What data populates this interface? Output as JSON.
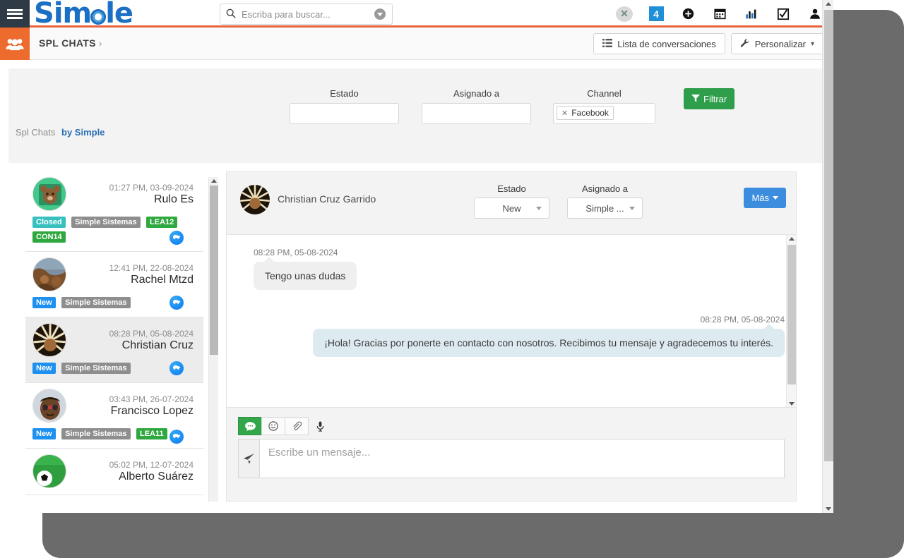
{
  "navbar": {
    "brand": "Simple",
    "menu_icon": "hamburger-icon",
    "search": {
      "placeholder": "Escriba para buscar...",
      "value": ""
    },
    "icons": [
      {
        "name": "xero-icon",
        "glyph": "✕"
      },
      {
        "name": "notification-count-icon",
        "glyph": "4"
      },
      {
        "name": "add-circle-icon",
        "glyph": "✚"
      },
      {
        "name": "calendar-icon",
        "glyph": "▦"
      },
      {
        "name": "chart-icon",
        "glyph": "▁▅▇"
      },
      {
        "name": "checklist-icon",
        "glyph": "☑"
      },
      {
        "name": "user-icon",
        "glyph": "👤"
      }
    ]
  },
  "breadcrumb": {
    "icon": "group-people-icon",
    "title": "SPL CHATS",
    "chevron": "›",
    "actions": [
      {
        "name": "conversation-list-button",
        "icon": "list-icon",
        "label": "Lista de conversaciones"
      },
      {
        "name": "customize-button",
        "icon": "wrench-icon",
        "label": "Personalizar",
        "caret": "▾"
      }
    ]
  },
  "filters": {
    "estado": {
      "label": "Estado",
      "value": ""
    },
    "asignado": {
      "label": "Asignado a",
      "value": ""
    },
    "channel": {
      "label": "Channel",
      "chip": "Facebook",
      "chip_remove": "✕"
    },
    "filter_button": {
      "label": "Filtrar",
      "icon": "funnel-icon",
      "color": "#2e9e4b"
    }
  },
  "byline": {
    "prefix": "Spl Chats",
    "link": "by Simple"
  },
  "conversations": [
    {
      "time": "01:27 PM, 03-09-2024",
      "name": "Rulo Es",
      "tags": [
        {
          "text": "Closed",
          "color": "#38c0c0",
          "cls": "closed"
        },
        {
          "text": "Simple Sistemas",
          "color": "#8e8e8e",
          "cls": "gray"
        },
        {
          "text": "LEA12",
          "color": "#2fa83f",
          "cls": "green"
        },
        {
          "text": "CON14",
          "color": "#2fa83f",
          "cls": "green"
        }
      ],
      "channel_icon": "facebook-messenger-icon",
      "active": false,
      "avatar_colors": [
        "#3ec48a",
        "#2f6f4a"
      ]
    },
    {
      "time": "12:41 PM, 22-08-2024",
      "name": "Rachel Mtzd",
      "tags": [
        {
          "text": "New",
          "color": "#1e90f0",
          "cls": "new"
        },
        {
          "text": "Simple Sistemas",
          "color": "#8e8e8e",
          "cls": "gray"
        }
      ],
      "channel_icon": "facebook-messenger-icon",
      "active": false,
      "avatar_colors": [
        "#9c6a3f",
        "#5c3a1e"
      ]
    },
    {
      "time": "08:28 PM, 05-08-2024",
      "name": "Christian Cruz",
      "tags": [
        {
          "text": "New",
          "color": "#1e90f0",
          "cls": "new"
        },
        {
          "text": "Simple Sistemas",
          "color": "#8e8e8e",
          "cls": "gray"
        }
      ],
      "channel_icon": "facebook-messenger-icon",
      "active": true,
      "avatar_colors": [
        "#e8d9b5",
        "#3a2c16"
      ]
    },
    {
      "time": "03:43 PM, 26-07-2024",
      "name": "Francisco Lopez",
      "tags": [
        {
          "text": "New",
          "color": "#1e90f0",
          "cls": "new"
        },
        {
          "text": "Simple Sistemas",
          "color": "#8e8e8e",
          "cls": "gray"
        },
        {
          "text": "LEA11",
          "color": "#2fa83f",
          "cls": "green"
        }
      ],
      "channel_icon": "facebook-messenger-icon",
      "active": false,
      "avatar_colors": [
        "#6a4a34",
        "#2a1a10"
      ]
    },
    {
      "time": "05:02 PM, 12-07-2024",
      "name": "Alberto Suárez",
      "tags": [],
      "channel_icon": "facebook-messenger-icon",
      "active": false,
      "avatar_colors": [
        "#2f9e3f",
        "#14621f"
      ]
    }
  ],
  "chat": {
    "contact_name": "Christian Cruz Garrido",
    "estado": {
      "label": "Estado",
      "value": "New"
    },
    "asignado": {
      "label": "Asignado a",
      "value": "Simple ..."
    },
    "more_button": {
      "label": "Más",
      "caret": "▾",
      "color": "#3c8dde"
    },
    "messages": [
      {
        "direction": "in",
        "time": "08:28 PM, 05-08-2024",
        "text": "Tengo unas dudas"
      },
      {
        "direction": "out",
        "time": "08:28 PM, 05-08-2024",
        "text": "¡Hola! Gracias por ponerte en contacto con nosotros. Recibimos tu mensaje y agradecemos tu interés."
      }
    ],
    "composer": {
      "placeholder": "Escribe un mensaje...",
      "value": "",
      "tools": [
        {
          "name": "text-message-tool",
          "glyph": "💬",
          "active": true
        },
        {
          "name": "emoji-tool",
          "glyph": "☺",
          "active": false
        },
        {
          "name": "attachment-tool",
          "glyph": "📎",
          "active": false
        },
        {
          "name": "voice-tool",
          "glyph": "🎤",
          "active": false
        }
      ],
      "send_icon": "send-paper-plane-icon"
    }
  }
}
